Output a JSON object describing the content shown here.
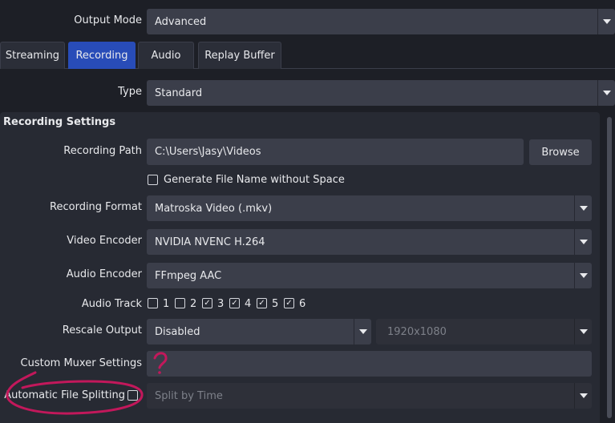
{
  "output_mode": {
    "label": "Output Mode",
    "value": "Advanced"
  },
  "tabs": [
    {
      "label": "Streaming",
      "active": false
    },
    {
      "label": "Recording",
      "active": true
    },
    {
      "label": "Audio",
      "active": false
    },
    {
      "label": "Replay Buffer",
      "active": false
    }
  ],
  "type": {
    "label": "Type",
    "value": "Standard"
  },
  "section_title": "Recording Settings",
  "recording_path": {
    "label": "Recording Path",
    "value": "C:\\Users\\Jasy\\Videos",
    "browse_label": "Browse"
  },
  "generate_filename": {
    "label": "Generate File Name without Space",
    "checked": false
  },
  "recording_format": {
    "label": "Recording Format",
    "value": "Matroska Video (.mkv)"
  },
  "video_encoder": {
    "label": "Video Encoder",
    "value": "NVIDIA NVENC H.264"
  },
  "audio_encoder": {
    "label": "Audio Encoder",
    "value": "FFmpeg AAC"
  },
  "audio_track": {
    "label": "Audio Track",
    "tracks": [
      {
        "label": "1",
        "checked": false
      },
      {
        "label": "2",
        "checked": false
      },
      {
        "label": "3",
        "checked": true
      },
      {
        "label": "4",
        "checked": true
      },
      {
        "label": "5",
        "checked": true
      },
      {
        "label": "6",
        "checked": true
      }
    ]
  },
  "rescale_output": {
    "label": "Rescale Output",
    "value": "Disabled",
    "resolution": "1920x1080"
  },
  "custom_muxer": {
    "label": "Custom Muxer Settings",
    "value": ""
  },
  "auto_split": {
    "label": "Automatic File Splitting",
    "checked": false,
    "mode": "Split by Time"
  },
  "annotation": {
    "question_mark": "?",
    "color": "#c2185b"
  },
  "colors": {
    "accent": "#284cb8",
    "background": "#1d1f26",
    "panel": "#272a33",
    "control": "#3b3e4a"
  }
}
